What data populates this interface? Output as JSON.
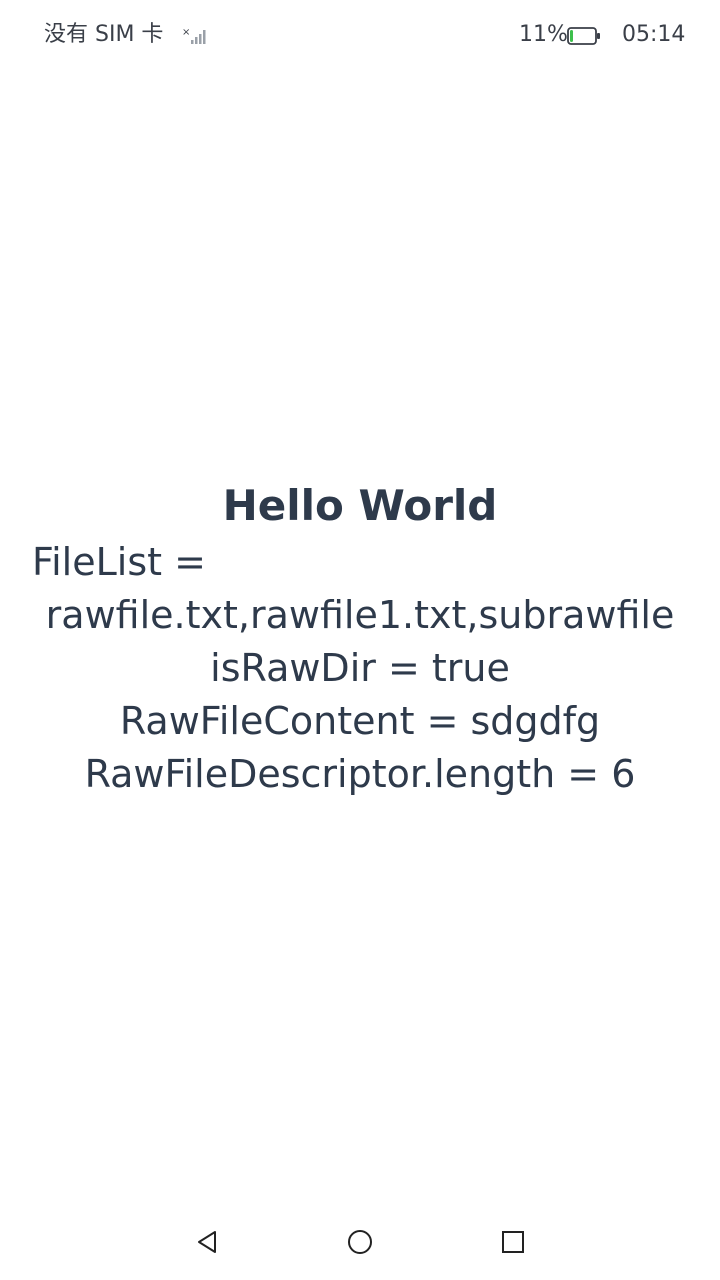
{
  "status_bar": {
    "sim_text": "没有 SIM 卡",
    "signal_icon": "signal-weak-icon",
    "battery_percent": "11%",
    "battery_icon": "battery-low-icon",
    "battery_level": 0.11,
    "battery_color": "#3dbf4c",
    "time": "05:14"
  },
  "content": {
    "title": "Hello World",
    "file_list_label": "FileList =",
    "file_list_value": "rawfile.txt,rawfile1.txt,subrawfile",
    "is_raw_dir": "isRawDir = true",
    "raw_file_content": "RawFileContent = sdgdfg",
    "raw_file_descriptor": "RawFileDescriptor.length = 6"
  },
  "nav_bar": {
    "back_icon": "back-triangle-icon",
    "home_icon": "home-circle-icon",
    "recent_icon": "recent-square-icon"
  }
}
